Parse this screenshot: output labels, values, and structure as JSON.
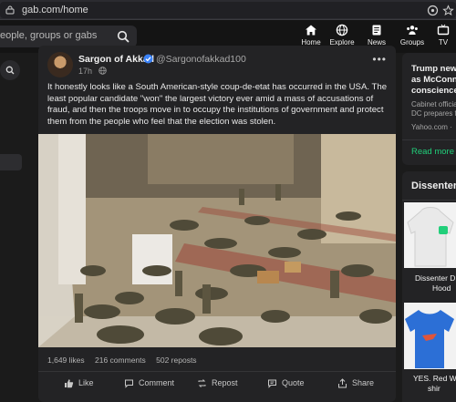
{
  "browser": {
    "url": "gab.com/home"
  },
  "topnav": {
    "search_placeholder": "eople, groups or gabs",
    "items": [
      {
        "label": "Home",
        "icon": "home-icon"
      },
      {
        "label": "Explore",
        "icon": "globe-icon"
      },
      {
        "label": "News",
        "icon": "news-icon"
      },
      {
        "label": "Groups",
        "icon": "groups-icon"
      },
      {
        "label": "TV",
        "icon": "tv-icon"
      }
    ]
  },
  "post": {
    "author": "Sargon of Akkad",
    "handle": "@Sargonofakkad100",
    "time": "17h",
    "text": "It honestly looks like a South American-style coup-de-etat has occurred in the USA. The least popular candidate \"won\" the largest victory ever amid a mass of accusations of fraud, and then the troops move in to occupy the institutions of government and protect them from the people who feel that the election was stolen.",
    "stats": {
      "likes": "1,649 likes",
      "comments": "216 comments",
      "reposts": "502 reposts"
    },
    "actions": [
      "Like",
      "Comment",
      "Repost",
      "Quote",
      "Share"
    ]
  },
  "sidebar": {
    "news_card": {
      "title_lines": [
        "Trump news",
        "as McConne",
        "conscience'"
      ],
      "snippet_lines": [
        "Cabinet officia",
        "DC prepares fo"
      ],
      "source": "Yahoo.com ·",
      "read_more": "Read more"
    },
    "shop_card": {
      "title": "Dissenter",
      "item1_lines": [
        "Dissenter D",
        "Hood"
      ],
      "item2_lines": [
        "YES. Red W",
        "shir"
      ]
    }
  },
  "colors": {
    "accent_green": "#21cf7a",
    "background": "#1b1b1b",
    "card": "#232325"
  }
}
